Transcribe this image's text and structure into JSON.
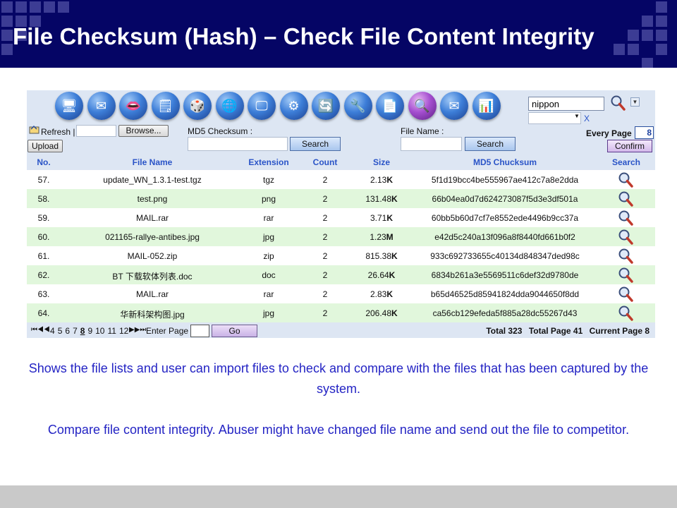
{
  "slide": {
    "title": "File Checksum (Hash) – Check File Content Integrity",
    "description_1": "Shows the file lists and user can import files to check and compare with the files that has been captured by the system.",
    "description_2": "Compare file content integrity. Abuser might have changed file name and send out the file to competitor.",
    "colors": {
      "header_bg": "#050565",
      "text_blue": "#2424c4",
      "row_alt": "#e1f7dc",
      "panel": "#dde6f3"
    }
  },
  "toolbar": {
    "icons": [
      "computer-icon",
      "mail-icon",
      "lips-icon",
      "notes-icon",
      "dice-icon",
      "globe-icon",
      "monitor-icon",
      "gear-icon",
      "refresh-globe-icon",
      "tools-icon",
      "document-icon",
      "magnifier-icon",
      "mail-send-icon",
      "bar-chart-icon"
    ],
    "search_value": "nippon",
    "clear_label": "X"
  },
  "controls": {
    "refresh_label": "Refresh |",
    "browse_label": "Browse...",
    "upload_label": "Upload",
    "md5_label": "MD5 Checksum :",
    "md5_search": "Search",
    "filename_label": "File Name :",
    "filename_search": "Search",
    "every_page_label": "Every Page",
    "every_page_value": "8",
    "confirm_label": "Confirm"
  },
  "table": {
    "headers": {
      "no": "No.",
      "file_name": "File Name",
      "extension": "Extension",
      "count": "Count",
      "size": "Size",
      "md5": "MD5 Chucksum",
      "search": "Search"
    },
    "rows": [
      {
        "no": "57.",
        "name": "update_WN_1.3.1-test.tgz",
        "ext": "tgz",
        "count": "2",
        "size_num": "2.13",
        "size_unit": "K",
        "md5": "5f1d19bcc4be555967ae412c7a8e2dda"
      },
      {
        "no": "58.",
        "name": "test.png",
        "ext": "png",
        "count": "2",
        "size_num": "131.48",
        "size_unit": "K",
        "md5": "66b04ea0d7d624273087f5d3e3df501a"
      },
      {
        "no": "59.",
        "name": "MAIL.rar",
        "ext": "rar",
        "count": "2",
        "size_num": "3.71",
        "size_unit": "K",
        "md5": "60bb5b60d7cf7e8552ede4496b9cc37a"
      },
      {
        "no": "60.",
        "name": "021165-rallye-antibes.jpg",
        "ext": "jpg",
        "count": "2",
        "size_num": "1.23",
        "size_unit": "M",
        "md5": "e42d5c240a13f096a8f8440fd661b0f2"
      },
      {
        "no": "61.",
        "name": "MAIL-052.zip",
        "ext": "zip",
        "count": "2",
        "size_num": "815.38",
        "size_unit": "K",
        "md5": "933c692733655c40134d848347ded98c"
      },
      {
        "no": "62.",
        "name": "BT 下载软体列表.doc",
        "ext": "doc",
        "count": "2",
        "size_num": "26.64",
        "size_unit": "K",
        "md5": "6834b261a3e5569511c6def32d9780de"
      },
      {
        "no": "63.",
        "name": "MAIL.rar",
        "ext": "rar",
        "count": "2",
        "size_num": "2.83",
        "size_unit": "K",
        "md5": "b65d46525d85941824dda9044650f8dd"
      },
      {
        "no": "64.",
        "name": "华新科架构图.jpg",
        "ext": "jpg",
        "count": "2",
        "size_num": "206.48",
        "size_unit": "K",
        "md5": "ca56cb129efeda5f885a28dc55267d43"
      }
    ]
  },
  "pager": {
    "first_prev": "⏮◀◀",
    "pages": [
      "4",
      "5",
      "6",
      "7",
      "8",
      "9",
      "10",
      "11",
      "12"
    ],
    "current": "8",
    "next_last": "▶▶⏭",
    "enter_label": "Enter Page",
    "go_label": "Go",
    "total": "Total 323",
    "total_page": "Total Page 41",
    "current_page": "Current Page 8"
  }
}
